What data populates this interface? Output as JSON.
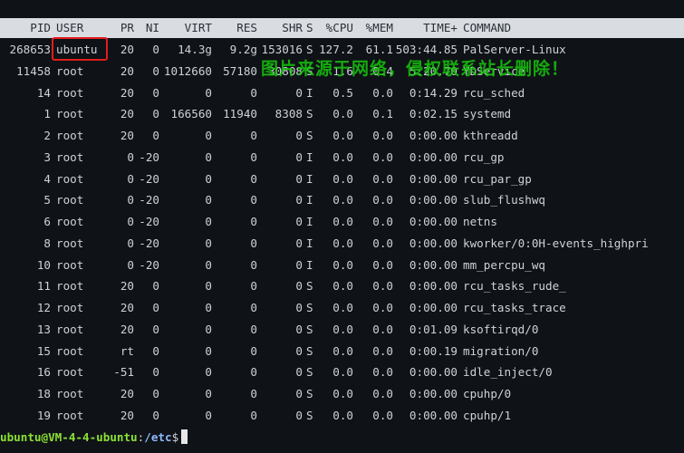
{
  "header": {
    "pid": "PID",
    "user": "USER",
    "pr": "PR",
    "ni": "NI",
    "virt": "VIRT",
    "res": "RES",
    "shr": "SHR",
    "s": "S",
    "cpu": "%CPU",
    "mem": "%MEM",
    "time": "TIME+",
    "command": "COMMAND"
  },
  "processes": [
    {
      "pid": "268653",
      "user": "ubuntu",
      "pr": "20",
      "ni": "0",
      "virt": "14.3g",
      "res": "9.2g",
      "shr": "153016",
      "s": "S",
      "cpu": "127.2",
      "mem": "61.1",
      "time": "503:44.85",
      "command": "PalServer-Linux"
    },
    {
      "pid": "11458",
      "user": "root",
      "pr": "20",
      "ni": "0",
      "virt": "1012660",
      "res": "57180",
      "shr": "30808",
      "s": "S",
      "cpu": "1.6",
      "mem": "0.4",
      "time": "5:20.70",
      "command": "YDService"
    },
    {
      "pid": "14",
      "user": "root",
      "pr": "20",
      "ni": "0",
      "virt": "0",
      "res": "0",
      "shr": "0",
      "s": "I",
      "cpu": "0.5",
      "mem": "0.0",
      "time": "0:14.29",
      "command": "rcu_sched"
    },
    {
      "pid": "1",
      "user": "root",
      "pr": "20",
      "ni": "0",
      "virt": "166560",
      "res": "11940",
      "shr": "8308",
      "s": "S",
      "cpu": "0.0",
      "mem": "0.1",
      "time": "0:02.15",
      "command": "systemd"
    },
    {
      "pid": "2",
      "user": "root",
      "pr": "20",
      "ni": "0",
      "virt": "0",
      "res": "0",
      "shr": "0",
      "s": "S",
      "cpu": "0.0",
      "mem": "0.0",
      "time": "0:00.00",
      "command": "kthreadd"
    },
    {
      "pid": "3",
      "user": "root",
      "pr": "0",
      "ni": "-20",
      "virt": "0",
      "res": "0",
      "shr": "0",
      "s": "I",
      "cpu": "0.0",
      "mem": "0.0",
      "time": "0:00.00",
      "command": "rcu_gp"
    },
    {
      "pid": "4",
      "user": "root",
      "pr": "0",
      "ni": "-20",
      "virt": "0",
      "res": "0",
      "shr": "0",
      "s": "I",
      "cpu": "0.0",
      "mem": "0.0",
      "time": "0:00.00",
      "command": "rcu_par_gp"
    },
    {
      "pid": "5",
      "user": "root",
      "pr": "0",
      "ni": "-20",
      "virt": "0",
      "res": "0",
      "shr": "0",
      "s": "I",
      "cpu": "0.0",
      "mem": "0.0",
      "time": "0:00.00",
      "command": "slub_flushwq"
    },
    {
      "pid": "6",
      "user": "root",
      "pr": "0",
      "ni": "-20",
      "virt": "0",
      "res": "0",
      "shr": "0",
      "s": "I",
      "cpu": "0.0",
      "mem": "0.0",
      "time": "0:00.00",
      "command": "netns"
    },
    {
      "pid": "8",
      "user": "root",
      "pr": "0",
      "ni": "-20",
      "virt": "0",
      "res": "0",
      "shr": "0",
      "s": "I",
      "cpu": "0.0",
      "mem": "0.0",
      "time": "0:00.00",
      "command": "kworker/0:0H-events_highpri"
    },
    {
      "pid": "10",
      "user": "root",
      "pr": "0",
      "ni": "-20",
      "virt": "0",
      "res": "0",
      "shr": "0",
      "s": "I",
      "cpu": "0.0",
      "mem": "0.0",
      "time": "0:00.00",
      "command": "mm_percpu_wq"
    },
    {
      "pid": "11",
      "user": "root",
      "pr": "20",
      "ni": "0",
      "virt": "0",
      "res": "0",
      "shr": "0",
      "s": "S",
      "cpu": "0.0",
      "mem": "0.0",
      "time": "0:00.00",
      "command": "rcu_tasks_rude_"
    },
    {
      "pid": "12",
      "user": "root",
      "pr": "20",
      "ni": "0",
      "virt": "0",
      "res": "0",
      "shr": "0",
      "s": "S",
      "cpu": "0.0",
      "mem": "0.0",
      "time": "0:00.00",
      "command": "rcu_tasks_trace"
    },
    {
      "pid": "13",
      "user": "root",
      "pr": "20",
      "ni": "0",
      "virt": "0",
      "res": "0",
      "shr": "0",
      "s": "S",
      "cpu": "0.0",
      "mem": "0.0",
      "time": "0:01.09",
      "command": "ksoftirqd/0"
    },
    {
      "pid": "15",
      "user": "root",
      "pr": "rt",
      "ni": "0",
      "virt": "0",
      "res": "0",
      "shr": "0",
      "s": "S",
      "cpu": "0.0",
      "mem": "0.0",
      "time": "0:00.19",
      "command": "migration/0"
    },
    {
      "pid": "16",
      "user": "root",
      "pr": "-51",
      "ni": "0",
      "virt": "0",
      "res": "0",
      "shr": "0",
      "s": "S",
      "cpu": "0.0",
      "mem": "0.0",
      "time": "0:00.00",
      "command": "idle_inject/0"
    },
    {
      "pid": "18",
      "user": "root",
      "pr": "20",
      "ni": "0",
      "virt": "0",
      "res": "0",
      "shr": "0",
      "s": "S",
      "cpu": "0.0",
      "mem": "0.0",
      "time": "0:00.00",
      "command": "cpuhp/0"
    },
    {
      "pid": "19",
      "user": "root",
      "pr": "20",
      "ni": "0",
      "virt": "0",
      "res": "0",
      "shr": "0",
      "s": "S",
      "cpu": "0.0",
      "mem": "0.0",
      "time": "0:00.00",
      "command": "cpuhp/1"
    }
  ],
  "watermark": "图片来源于网络，侵权联系站长删除！",
  "prompt": {
    "user_host": "ubuntu@VM-4-4-ubuntu",
    "colon": ":",
    "path": "/etc",
    "symbol": "$"
  },
  "colors": {
    "header_bg": "#d9dde2",
    "highlight_border": "#e11d1d",
    "watermark": "#16c60c",
    "prompt_user": "#8ae234",
    "prompt_path": "#8db8ff"
  }
}
